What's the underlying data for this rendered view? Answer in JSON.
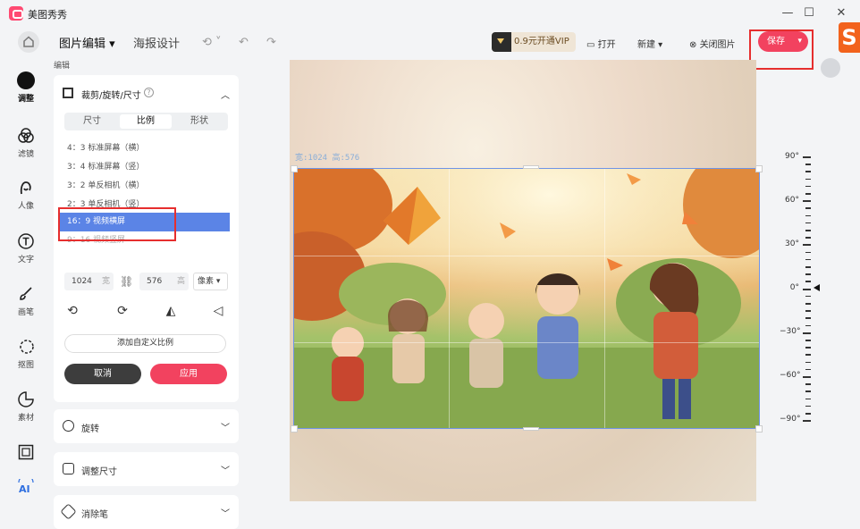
{
  "app": {
    "title": "美图秀秀"
  },
  "window": {
    "minimize": "—",
    "maximize": "☐",
    "close": "✕"
  },
  "toolbar": {
    "tabs": [
      {
        "label": "图片编辑",
        "active": true
      },
      {
        "label": "海报设计",
        "active": false
      }
    ],
    "vip_label": "0.9元开通VIP",
    "open_label": "打开",
    "new_label": "新建",
    "close_image_label": "关闭图片",
    "save_label": "保存"
  },
  "nav": {
    "items": [
      {
        "label": "调整",
        "icon": "adjust-icon",
        "active": true
      },
      {
        "label": "滤镜",
        "icon": "filter-icon",
        "active": false
      },
      {
        "label": "人像",
        "icon": "portrait-icon",
        "active": false
      },
      {
        "label": "文字",
        "icon": "text-icon",
        "active": false
      },
      {
        "label": "画笔",
        "icon": "brush-icon",
        "active": false
      },
      {
        "label": "抠图",
        "icon": "cutout-icon",
        "active": false
      },
      {
        "label": "素材",
        "icon": "sticker-icon",
        "active": false
      },
      {
        "label": "",
        "icon": "frame-icon",
        "active": false
      },
      {
        "label": "",
        "icon": "ai-icon",
        "active": false
      }
    ]
  },
  "panel": {
    "section_label": "编辑",
    "title": "裁剪/旋转/尺寸",
    "segments": [
      {
        "label": "尺寸",
        "active": false
      },
      {
        "label": "比例",
        "active": true
      },
      {
        "label": "形状",
        "active": false
      }
    ],
    "ratios": [
      {
        "label": "4：3 标准屏幕（横）",
        "selected": false
      },
      {
        "label": "3：4 标准屏幕（竖）",
        "selected": false
      },
      {
        "label": "3：2 单反相机（横）",
        "selected": false
      },
      {
        "label": "2：3 单反相机（竖）",
        "selected": false
      },
      {
        "label": "16：9 视频横屏",
        "selected": true
      },
      {
        "label": "9：16 视频竖屏",
        "selected": false
      }
    ],
    "width_value": "1024",
    "width_unit": "宽",
    "height_value": "576",
    "height_unit": "高",
    "unit_select": "像素",
    "custom_ratio_label": "添加自定义比例",
    "cancel_label": "取消",
    "apply_label": "应用"
  },
  "accordions": [
    {
      "label": "旋转",
      "icon": "rotate-icon"
    },
    {
      "label": "调整尺寸",
      "icon": "resize-icon"
    },
    {
      "label": "消除笔",
      "icon": "eraser-icon"
    }
  ],
  "canvas": {
    "size_readout": "宽:1024 高:576"
  },
  "ruler": {
    "labels": [
      "90°",
      "60°",
      "30°",
      "0°",
      "−30°",
      "−60°",
      "−90°"
    ],
    "current_value": 0
  }
}
